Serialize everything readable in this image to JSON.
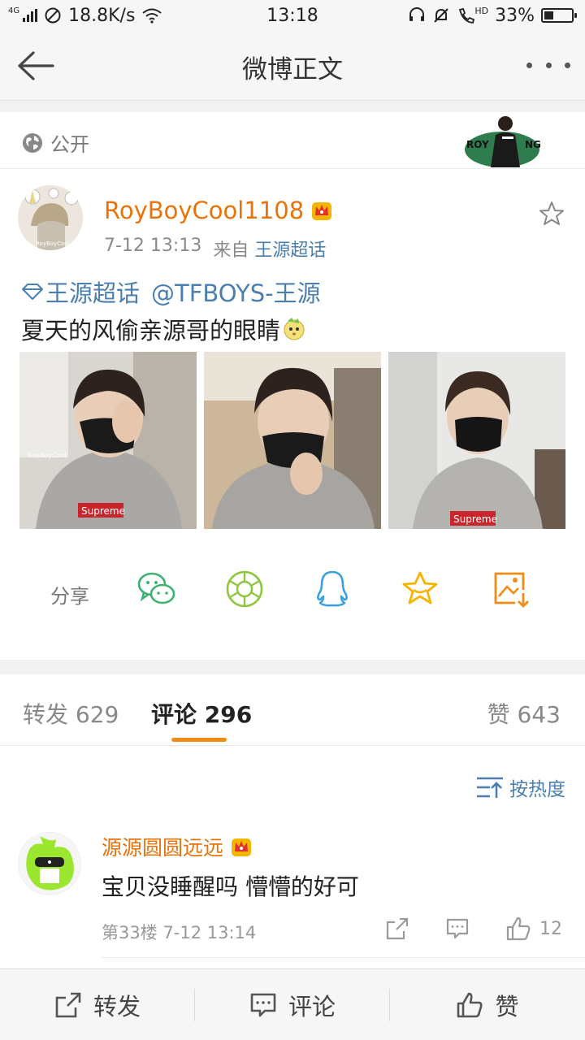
{
  "status_bar": {
    "network": "4G",
    "speed": "18.8K/s",
    "time": "13:18",
    "hd": "HD",
    "battery": "33%",
    "battery_level": 0.33
  },
  "header": {
    "title": "微博正文"
  },
  "visibility": {
    "label": "公开"
  },
  "post": {
    "username": "RoyBoyCool1108",
    "time": "7-12 13:13",
    "source_prefix": "来自",
    "source": "王源超话",
    "topic": "王源超话",
    "mention": "@TFBOYS-王源",
    "text": "夏天的风偷亲源哥的眼睛",
    "avatar_watermark": "RoyBoyCool",
    "photo_watermark": "RoyBoyCool",
    "shirt_text": "Supreme",
    "badge_text": "ROY",
    "badge_text2": "NG",
    "share_label": "分享"
  },
  "tabs": {
    "repost": "转发",
    "repost_count": "629",
    "comment": "评论",
    "comment_count": "296",
    "like": "赞",
    "like_count": "643"
  },
  "sort": {
    "label": "按热度"
  },
  "comment": {
    "username": "源源圆圆远远",
    "text": "宝贝没睡醒吗  懵懵的好可",
    "floor": "第33楼",
    "time": "7-12 13:14",
    "like_count": "12"
  },
  "bottom_bar": {
    "repost": "转发",
    "comment": "评论",
    "like": "赞"
  },
  "colors": {
    "accent_orange": "#e8730a",
    "link_blue": "#4b7fb0",
    "tab_underline": "#f08c14",
    "wechat": "#3cb371",
    "moments": "#8ec63f",
    "qq": "#3aa0e0",
    "favorite": "#f5b400"
  }
}
